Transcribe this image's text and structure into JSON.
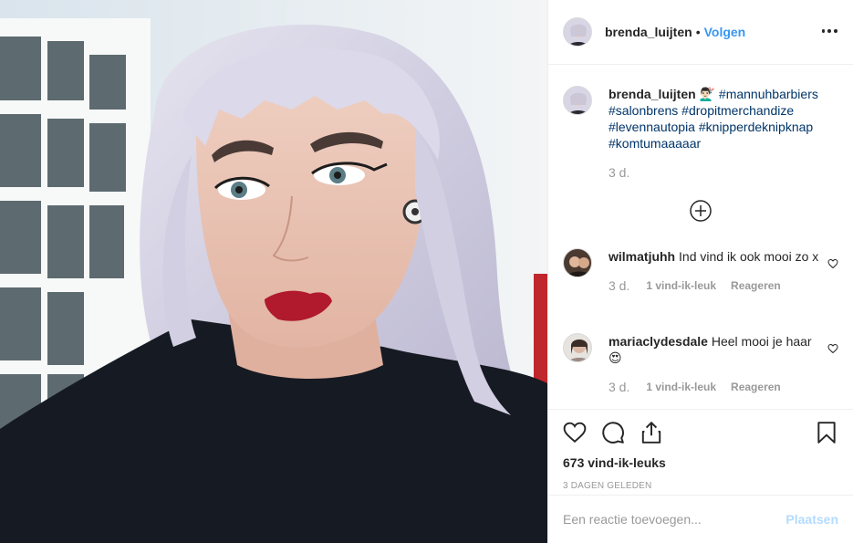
{
  "post": {
    "photo_alt": "",
    "author": {
      "username": "brenda_luijten",
      "avatar_icon": "profile-avatar"
    },
    "follow_label": "Volgen",
    "separator": "•",
    "more_icon": "more-options-icon"
  },
  "caption": {
    "username": "brenda_luijten",
    "emoji": "💇🏻‍♂️",
    "hashtags": [
      "#mannuhbarbiers",
      "#salonbrens",
      "#dropitmerchandize",
      "#levennautopia",
      "#knipperdeknipknap",
      "#komtumaaaaar"
    ],
    "time": "3 d."
  },
  "load_more_icon": "plus-circle-icon",
  "comments": [
    {
      "username": "wilmatjuhh",
      "text": "Ind vind ik ook mooi zo x",
      "time": "3 d.",
      "likes": "1 vind-ik-leuk",
      "reply": "Reageren"
    },
    {
      "username": "mariaclydesdale",
      "text": "Heel mooi je haar 😍",
      "time": "3 d.",
      "likes": "1 vind-ik-leuk",
      "reply": "Reageren"
    }
  ],
  "footer": {
    "likes_count": "673 vind-ik-leuks",
    "date": "3 DAGEN GELEDEN",
    "comment_placeholder": "Een reactie toevoegen...",
    "post_label": "Plaatsen"
  },
  "colors": {
    "link_blue": "#3897f0",
    "hashtag": "#003569",
    "muted": "#999999",
    "disabled_blue": "#b3dbff"
  }
}
